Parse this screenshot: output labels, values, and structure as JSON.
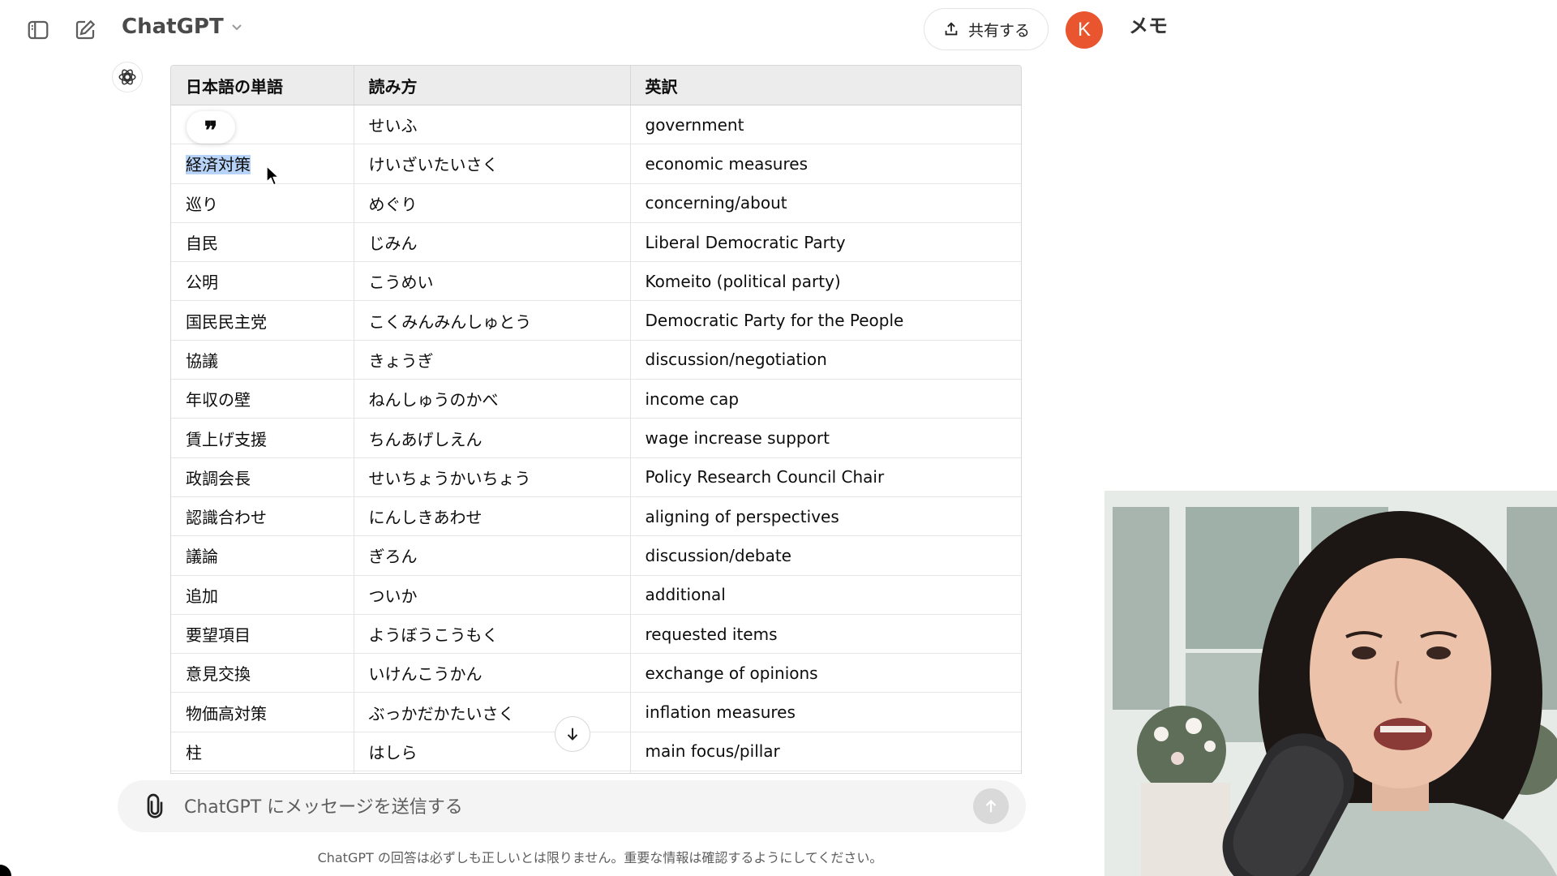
{
  "header": {
    "model_name": "ChatGPT",
    "share_label": "共有する",
    "avatar_initial": "K",
    "memo_label": "メモ"
  },
  "table": {
    "headers": [
      "日本語の単語",
      "読み方",
      "英訳"
    ],
    "rows": [
      [
        "",
        "せいふ",
        "government"
      ],
      [
        "経済対策",
        "けいざいたいさく",
        "economic measures"
      ],
      [
        "巡り",
        "めぐり",
        "concerning/about"
      ],
      [
        "自民",
        "じみん",
        "Liberal Democratic Party"
      ],
      [
        "公明",
        "こうめい",
        "Komeito (political party)"
      ],
      [
        "国民民主党",
        "こくみんみんしゅとう",
        "Democratic Party for the People"
      ],
      [
        "協議",
        "きょうぎ",
        "discussion/negotiation"
      ],
      [
        "年収の壁",
        "ねんしゅうのかべ",
        "income cap"
      ],
      [
        "賃上げ支援",
        "ちんあげしえん",
        "wage increase support"
      ],
      [
        "政調会長",
        "せいちょうかいちょう",
        "Policy Research Council Chair"
      ],
      [
        "認識合わせ",
        "にんしきあわせ",
        "aligning of perspectives"
      ],
      [
        "議論",
        "ぎろん",
        "discussion/debate"
      ],
      [
        "追加",
        "ついか",
        "additional"
      ],
      [
        "要望項目",
        "ようぼうこうもく",
        "requested items"
      ],
      [
        "意見交換",
        "いけんこうかん",
        "exchange of opinions"
      ],
      [
        "物価高対策",
        "ぶっかだかたいさく",
        "inflation measures"
      ],
      [
        "柱",
        "はしら",
        "main focus/pillar"
      ]
    ],
    "quote_glyph": "❞"
  },
  "composer": {
    "placeholder": "ChatGPT にメッセージを送信する"
  },
  "footer": {
    "disclaimer": "ChatGPT の回答は必ずしも正しいとは限りません。重要な情報は確認するようにしてください。"
  },
  "colors": {
    "avatar": "#e9552f",
    "selection": "#b7d3f7",
    "header_bg": "#ececec"
  },
  "icons": [
    "sidebar-toggle-icon",
    "new-chat-icon",
    "chevron-down-icon",
    "share-icon",
    "openai-logo-icon",
    "arrow-down-icon",
    "paperclip-icon",
    "arrow-up-icon",
    "mouse-cursor-icon",
    "quote-icon"
  ]
}
